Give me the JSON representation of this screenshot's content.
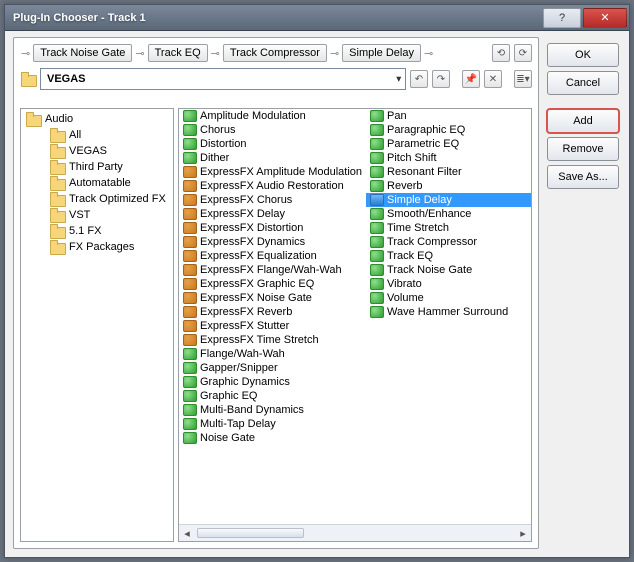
{
  "window": {
    "title": "Plug-In Chooser - Track 1"
  },
  "buttons": {
    "ok": "OK",
    "cancel": "Cancel",
    "add": "Add",
    "remove": "Remove",
    "saveas": "Save As..."
  },
  "chain": [
    "Track Noise Gate",
    "Track EQ",
    "Track Compressor",
    "Simple Delay"
  ],
  "combo": {
    "selected": "VEGAS"
  },
  "tree": {
    "root": "Audio",
    "items": [
      "All",
      "VEGAS",
      "Third Party",
      "Automatable",
      "Track Optimized FX",
      "VST",
      "5.1 FX",
      "FX Packages"
    ]
  },
  "plugins_col1": [
    {
      "icon": "a",
      "name": "Amplitude Modulation"
    },
    {
      "icon": "a",
      "name": "Chorus"
    },
    {
      "icon": "a",
      "name": "Distortion"
    },
    {
      "icon": "a",
      "name": "Dither"
    },
    {
      "icon": "b",
      "name": "ExpressFX Amplitude Modulation"
    },
    {
      "icon": "b",
      "name": "ExpressFX Audio Restoration"
    },
    {
      "icon": "b",
      "name": "ExpressFX Chorus"
    },
    {
      "icon": "b",
      "name": "ExpressFX Delay"
    },
    {
      "icon": "b",
      "name": "ExpressFX Distortion"
    },
    {
      "icon": "b",
      "name": "ExpressFX Dynamics"
    },
    {
      "icon": "b",
      "name": "ExpressFX Equalization"
    },
    {
      "icon": "b",
      "name": "ExpressFX Flange/Wah-Wah"
    },
    {
      "icon": "b",
      "name": "ExpressFX Graphic EQ"
    },
    {
      "icon": "b",
      "name": "ExpressFX Noise Gate"
    },
    {
      "icon": "b",
      "name": "ExpressFX Reverb"
    },
    {
      "icon": "b",
      "name": "ExpressFX Stutter"
    },
    {
      "icon": "b",
      "name": "ExpressFX Time Stretch"
    },
    {
      "icon": "a",
      "name": "Flange/Wah-Wah"
    },
    {
      "icon": "a",
      "name": "Gapper/Snipper"
    },
    {
      "icon": "a",
      "name": "Graphic Dynamics"
    },
    {
      "icon": "a",
      "name": "Graphic EQ"
    },
    {
      "icon": "a",
      "name": "Multi-Band Dynamics"
    },
    {
      "icon": "a",
      "name": "Multi-Tap Delay"
    },
    {
      "icon": "a",
      "name": "Noise Gate"
    }
  ],
  "plugins_col2": [
    {
      "icon": "a",
      "name": "Pan"
    },
    {
      "icon": "a",
      "name": "Paragraphic EQ"
    },
    {
      "icon": "a",
      "name": "Parametric EQ"
    },
    {
      "icon": "a",
      "name": "Pitch Shift"
    },
    {
      "icon": "a",
      "name": "Resonant Filter"
    },
    {
      "icon": "a",
      "name": "Reverb"
    },
    {
      "icon": "c",
      "name": "Simple Delay",
      "selected": true
    },
    {
      "icon": "a",
      "name": "Smooth/Enhance"
    },
    {
      "icon": "a",
      "name": "Time Stretch"
    },
    {
      "icon": "a",
      "name": "Track Compressor"
    },
    {
      "icon": "a",
      "name": "Track EQ"
    },
    {
      "icon": "a",
      "name": "Track Noise Gate"
    },
    {
      "icon": "a",
      "name": "Vibrato"
    },
    {
      "icon": "a",
      "name": "Volume"
    },
    {
      "icon": "a",
      "name": "Wave Hammer Surround"
    }
  ],
  "scroll_marker": "III"
}
